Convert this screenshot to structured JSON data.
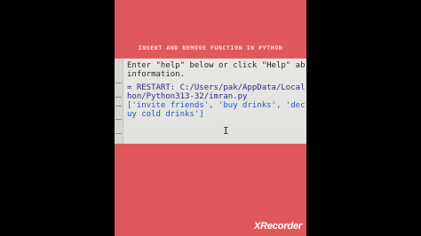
{
  "overlay_title": "INSERT AND REMOVE FUNCTION IN PYTHON",
  "console": {
    "lines": [
      "Enter \"help\" below or click \"Help\" ab",
      "information.",
      "= RESTART: C:/Users/pak/AppData/Local",
      "hon/Python313-32/imran.py",
      "['invite friends', 'buy drinks', 'dec",
      "uy cold drinks']"
    ]
  },
  "watermark": "XRecorder",
  "colors": {
    "background": "#000000",
    "frame": "#e0585c",
    "screen": "#e4e4e0",
    "output_text": "#2659c8",
    "restart_text": "#2c2c86"
  },
  "icons": {
    "cursor": "text-cursor-icon"
  }
}
